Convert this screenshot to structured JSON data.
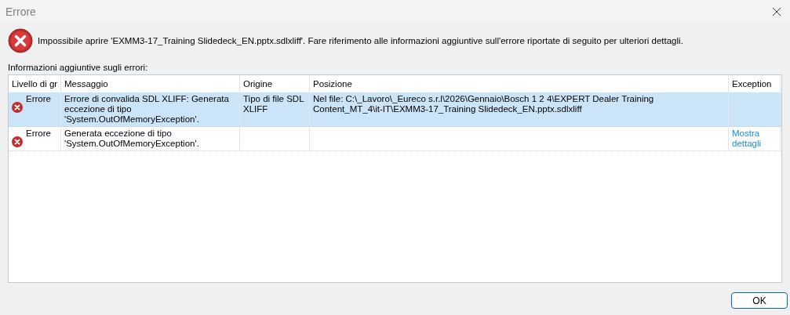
{
  "window": {
    "title": "Errore"
  },
  "message": "Impossibile aprire 'EXMM3-17_Training Slidedeck_EN.pptx.sdlxliff'. Fare riferimento alle informazioni aggiuntive sull'errore riportate di seguito per ulteriori dettagli.",
  "details_label": "Informazioni aggiuntive sugli errori:",
  "table": {
    "columns": [
      "Livello di gr",
      "Messaggio",
      "Origine",
      "Posizione",
      "Exception"
    ],
    "rows": [
      {
        "level": "Errore",
        "message": "Errore di convalida SDL XLIFF: Generata eccezione di tipo 'System.OutOfMemoryException'.",
        "origin": "Tipo di file SDL XLIFF",
        "position": "Nel file: C:\\_Lavoro\\_Eureco s.r.l\\2026\\Gennaio\\Bosch 1 2 4\\EXPERT Dealer Training Content_MT_4\\it-IT\\EXMM3-17_Training Slidedeck_EN.pptx.sdlxliff",
        "exception_link": "",
        "selected": true
      },
      {
        "level": "Errore",
        "message": "Generata eccezione di tipo 'System.OutOfMemoryException'.",
        "origin": "",
        "position": "",
        "exception_link": "Mostra dettagli",
        "selected": false
      }
    ]
  },
  "buttons": [
    "OK"
  ]
}
